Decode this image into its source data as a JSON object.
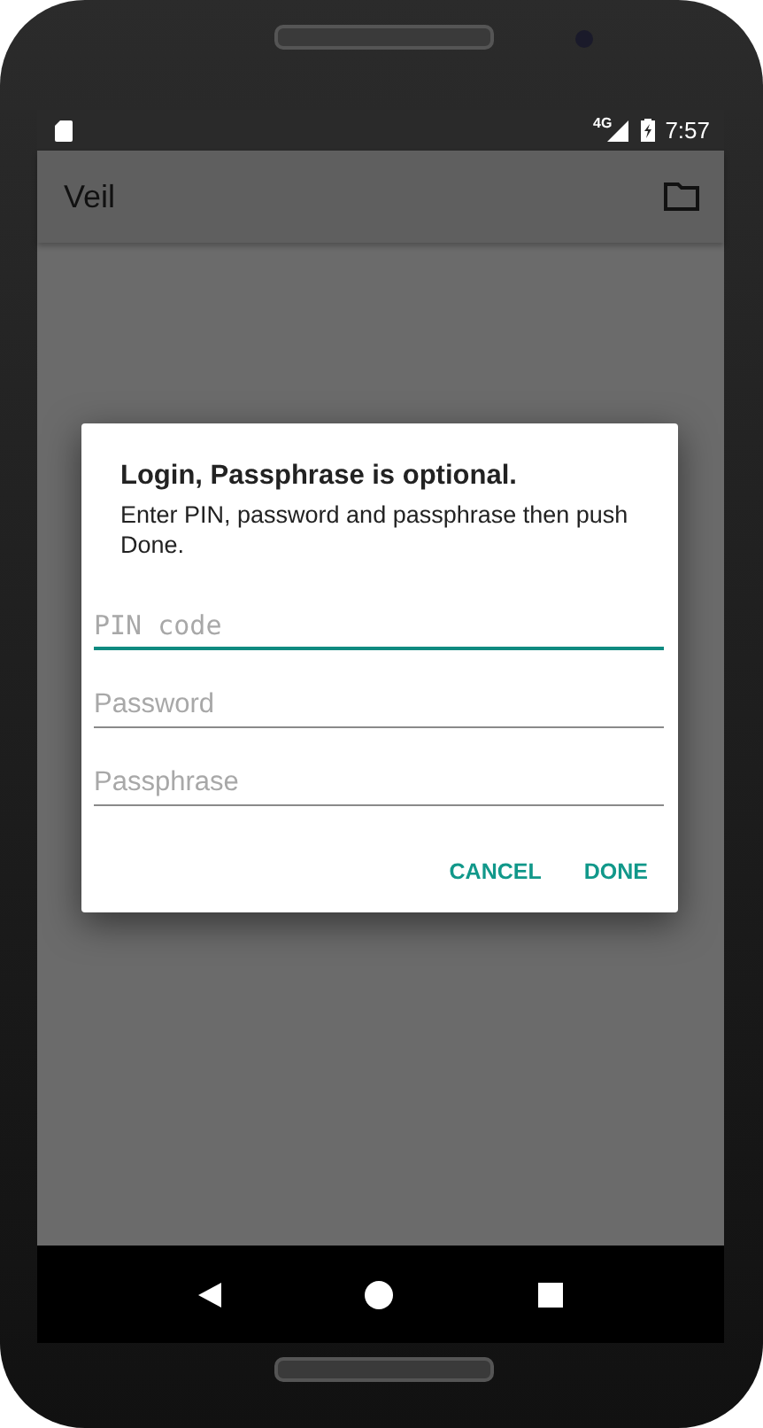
{
  "status_bar": {
    "network": "4G",
    "time": "7:57"
  },
  "app_bar": {
    "title": "Veil"
  },
  "dialog": {
    "title": "Login, Passphrase is optional.",
    "message": "Enter PIN, password and passphrase then push Done.",
    "fields": [
      {
        "kind": "pin",
        "placeholder": "PIN code",
        "focused": true
      },
      {
        "kind": "text",
        "placeholder": "Password",
        "focused": false
      },
      {
        "kind": "text",
        "placeholder": "Passphrase",
        "focused": false
      }
    ],
    "buttons": [
      "CANCEL",
      "DONE"
    ]
  }
}
